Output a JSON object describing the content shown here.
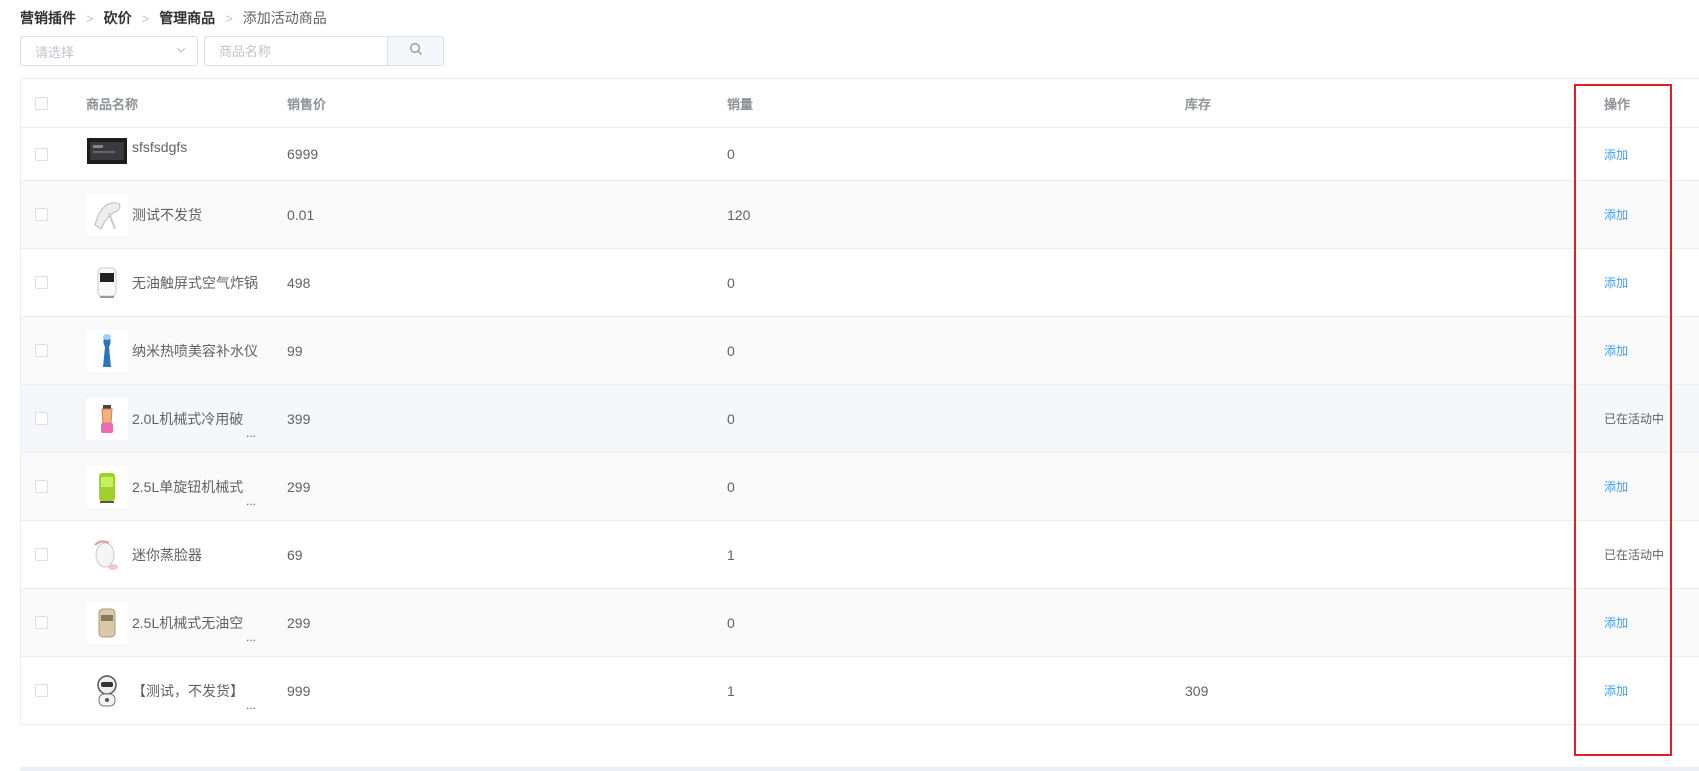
{
  "breadcrumb": [
    "营销插件",
    "砍价",
    "管理商品",
    "添加活动商品"
  ],
  "filter": {
    "select_placeholder": "请选择",
    "search_placeholder": "商品名称"
  },
  "table": {
    "headers": {
      "name": "商品名称",
      "price": "销售价",
      "sales": "销量",
      "stock": "库存",
      "op": "操作"
    },
    "rows": [
      {
        "name": "sfsfsdgfs",
        "truncated": false,
        "price": "6999",
        "sales": "0",
        "stock": "",
        "op": "添加",
        "op_link": true,
        "thumb": "tablet"
      },
      {
        "name": "测试不发货",
        "truncated": false,
        "price": "0.01",
        "sales": "120",
        "stock": "",
        "op": "添加",
        "op_link": true,
        "thumb": "hand-mixer"
      },
      {
        "name": "无油触屏式空气炸锅",
        "truncated": false,
        "price": "498",
        "sales": "0",
        "stock": "",
        "op": "添加",
        "op_link": true,
        "thumb": "air-fryer"
      },
      {
        "name": "纳米热喷美容补水仪",
        "truncated": false,
        "price": "99",
        "sales": "0",
        "stock": "",
        "op": "添加",
        "op_link": true,
        "thumb": "facial-sprayer"
      },
      {
        "name": "2.0L机械式冷用破",
        "truncated": true,
        "price": "399",
        "sales": "0",
        "stock": "",
        "op": "已在活动中",
        "op_link": false,
        "thumb": "blender"
      },
      {
        "name": "2.5L单旋钮机械式",
        "truncated": true,
        "price": "299",
        "sales": "0",
        "stock": "",
        "op": "添加",
        "op_link": true,
        "thumb": "green-fryer"
      },
      {
        "name": "迷你蒸脸器",
        "truncated": false,
        "price": "69",
        "sales": "1",
        "stock": "",
        "op": "已在活动中",
        "op_link": false,
        "thumb": "face-steamer"
      },
      {
        "name": "2.5L机械式无油空",
        "truncated": true,
        "price": "299",
        "sales": "0",
        "stock": "",
        "op": "添加",
        "op_link": true,
        "thumb": "gold-fryer"
      },
      {
        "name": "【测试，不发货】",
        "truncated": true,
        "price": "999",
        "sales": "1",
        "stock": "309",
        "op": "添加",
        "op_link": true,
        "thumb": "robot"
      }
    ]
  },
  "colors": {
    "link": "#409eff",
    "highlight": "#e51c23",
    "hover_row": "#f5f7fa",
    "striped_row": "#fafafa"
  },
  "ellipsis": "..."
}
